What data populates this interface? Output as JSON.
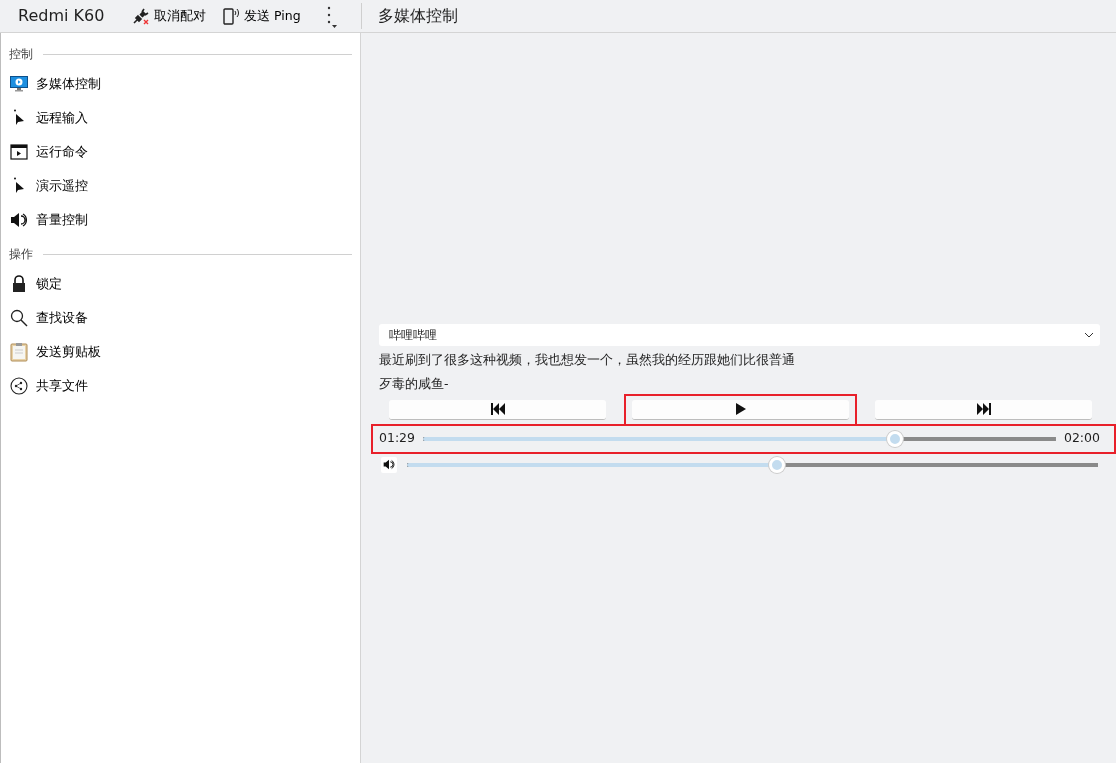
{
  "device": {
    "name": "Redmi K60"
  },
  "toolbar": [
    {
      "label": "取消配对",
      "kind": "unpair"
    },
    {
      "label": "发送 Ping",
      "kind": "ping"
    }
  ],
  "page_title": "多媒体控制",
  "sidebar": {
    "groups": [
      {
        "title": "控制",
        "items": [
          {
            "label": "多媒体控制",
            "kind": "media"
          },
          {
            "label": "远程输入",
            "kind": "pointer"
          },
          {
            "label": "运行命令",
            "kind": "run"
          },
          {
            "label": "演示遥控",
            "kind": "pointer"
          },
          {
            "label": "音量控制",
            "kind": "volume"
          }
        ]
      },
      {
        "title": "操作",
        "items": [
          {
            "label": "锁定",
            "kind": "lock"
          },
          {
            "label": "查找设备",
            "kind": "search"
          },
          {
            "label": "发送剪贴板",
            "kind": "clipboard"
          },
          {
            "label": "共享文件",
            "kind": "share"
          }
        ]
      }
    ]
  },
  "player": {
    "source": "哔哩哔哩",
    "title": "最近刷到了很多这种视频，我也想发一个，虽然我的经历跟她们比很普通",
    "artist": "歹毒的咸鱼-",
    "buttons": [
      {
        "kind": "previous",
        "highlighted": false
      },
      {
        "kind": "play",
        "highlighted": true
      },
      {
        "kind": "next",
        "highlighted": false
      }
    ],
    "position": {
      "elapsed": "01:29",
      "level": 0.746,
      "total": "02:00",
      "highlighted": true
    },
    "volume": {
      "level": 0.536
    }
  }
}
